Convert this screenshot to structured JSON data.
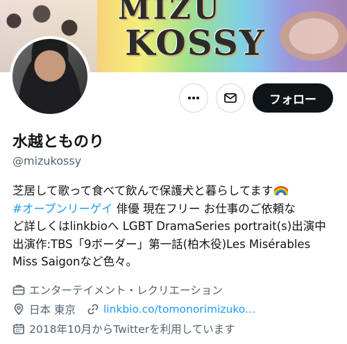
{
  "banner": {
    "logo_line1": "MIZU",
    "logo_line2": "KOSSY"
  },
  "profile": {
    "display_name": "水越とものり",
    "handle": "@mizukossy"
  },
  "actions": {
    "follow_label": "フォロー"
  },
  "bio": {
    "line1": "芝居して歌って食べて飲んで保護犬と暮らしてます",
    "hashtag": "#オープンリーゲイ",
    "line2_rest": " 俳優 現在フリー お仕事のご依頼な",
    "line3": "ど詳しくはlinkbioへ  LGBT DramaSeries portrait(s)出演中",
    "line4": "出演作:TBS「9ボーダー」第一話(柏木役)Les Misérables",
    "line5": "Miss Saigonなど色々。"
  },
  "meta": {
    "category": "エンターテイメント・レクリエーション",
    "location": "日本 東京",
    "link": "linkbio.co/tomonorimizuko...",
    "joined": "2018年10月からTwitterを利用しています"
  },
  "colors": {
    "accent": "#1d9bf0",
    "text": "#0f1419",
    "secondary": "#536471"
  }
}
